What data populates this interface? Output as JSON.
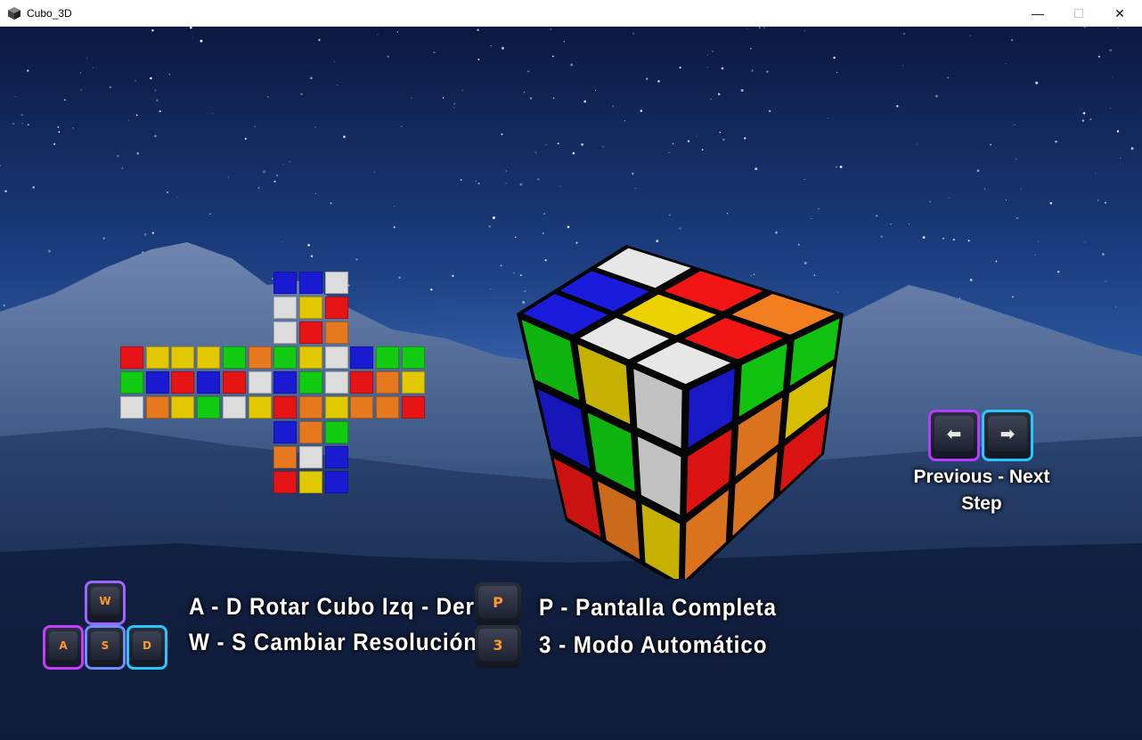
{
  "window": {
    "title": "Cubo_3D",
    "minimize_glyph": "—",
    "maximize_glyph": "☐",
    "close_glyph": "✕"
  },
  "colors": {
    "W": "#dcdcdc",
    "Y": "#e1c800",
    "R": "#e61414",
    "O": "#e6781e",
    "G": "#12cc12",
    "B": "#1a1ad2"
  },
  "net": {
    "top": [
      "BBW",
      "WYR",
      "WRO"
    ],
    "left": [
      "RYY",
      "GBR",
      "WOY"
    ],
    "front": [
      "YGO",
      "BRW",
      "GWY"
    ],
    "right": [
      "GYW",
      "BGW",
      "ROY"
    ],
    "back": [
      "BGG",
      "ROY",
      "OOR"
    ],
    "bottom": [
      "BOG",
      "OWB",
      "RYB"
    ]
  },
  "cube": {
    "top": [
      "BBW",
      "WYR",
      "WRO"
    ],
    "left": [
      "GYW",
      "BGW",
      "ROY"
    ],
    "right": [
      "BGG",
      "ROY",
      "OOR"
    ]
  },
  "step_controls": {
    "prev_icon": "arrow-left-icon",
    "next_icon": "arrow-right-icon",
    "prev_glyph": "⬅",
    "next_glyph": "➡",
    "label_line1": "Previous - Next",
    "label_line2": "Step"
  },
  "keys": {
    "w": "W",
    "a": "A",
    "s": "S",
    "d": "D",
    "p": "P",
    "three": "3"
  },
  "instructions": {
    "ad": "A - D  Rotar Cubo Izq - Der",
    "ws": "W - S  Cambiar Resolución",
    "p": "P - Pantalla Completa",
    "three": "3 - Modo Automático"
  }
}
